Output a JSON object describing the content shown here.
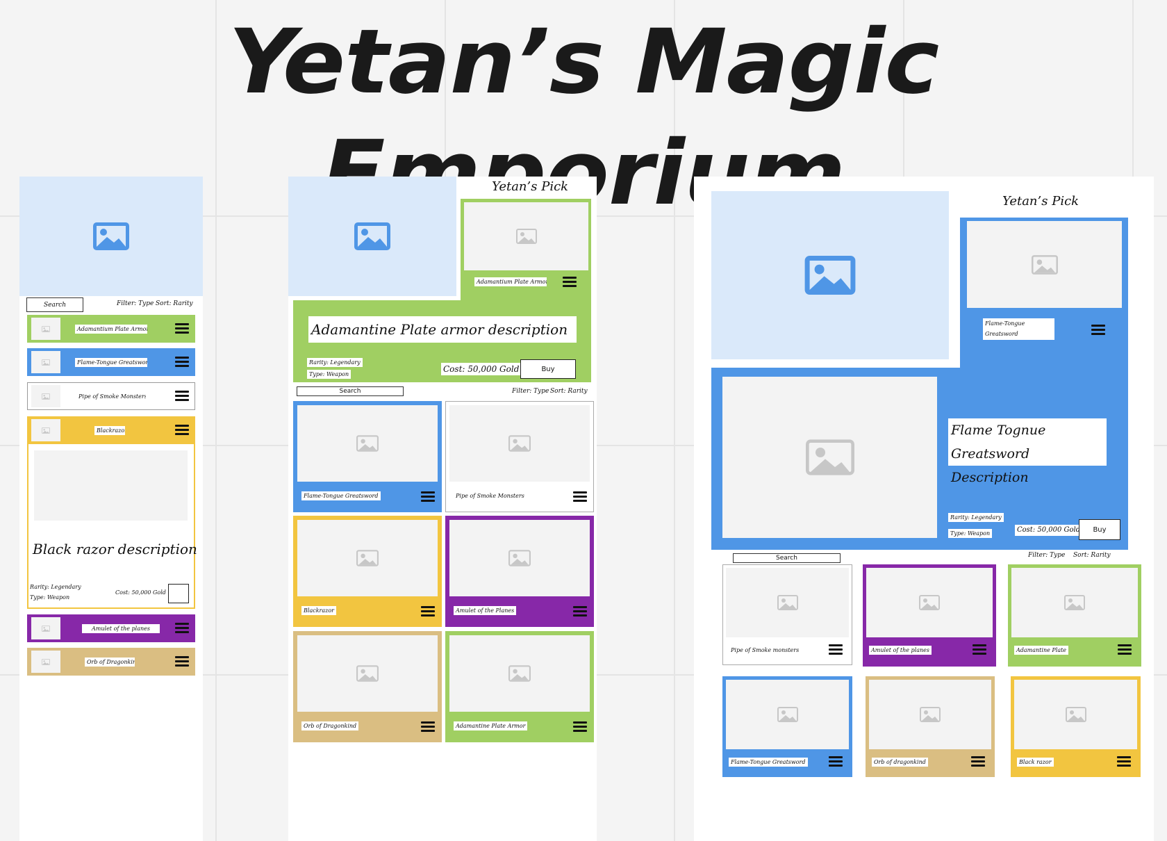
{
  "title": "Yetan’s Magic Emporium",
  "common": {
    "search": "Search",
    "filter": "Filter: Type",
    "sort": "Sort: Rarity",
    "buy": "Buy",
    "pick_heading": "Yetan’s Pick",
    "rarity": "Rarity: Legendary",
    "type": "Type: Weapon",
    "cost": "Cost: 50,000 Gold"
  },
  "mobile": {
    "items": [
      "Adamantium Plate Armor",
      "Flame-Tongue Greatsword",
      "Pipe of Smoke Monsters",
      "Blackrazor",
      "Amulet of the planes",
      "Orb of Dragonkind"
    ],
    "description": "Black razor description",
    "rarity": "Rarity: Legendary",
    "type": "Type: Weapon",
    "cost": "Cost: 50,000 Gold"
  },
  "tablet": {
    "pick_label": "Adamantium Plate Armor",
    "description": "Adamantine Plate armor description",
    "rarity": "Rarity: Legendary",
    "type": "Type: Weapon",
    "grid": [
      "Flame-Tongue Greatsword",
      "Pipe of Smoke Monsters",
      "Blackrazor",
      "Amulet of the Planes",
      "Orb of Dragonkind",
      "Adamantine Plate Armor"
    ]
  },
  "desktop": {
    "pick_label": "Flame-Tongue Greatsword",
    "description": "Flame Tognue Greatsword Description",
    "grid": [
      "Pipe of Smoke monsters",
      "Amulet of the planes",
      "Adamantine Plate",
      "Flame-Tongue Greatsword",
      "Orb of dragonkind",
      "Black razor"
    ]
  },
  "colors": {
    "green": "#a0cf62",
    "blue": "#4f96e6",
    "yellow": "#f2c540",
    "purple": "#8728a8",
    "tan": "#dabe82",
    "hero": "#dae9fa",
    "placeholder": "#f3f3f3"
  },
  "icons": [
    "image-placeholder-icon",
    "hamburger-menu-icon"
  ]
}
